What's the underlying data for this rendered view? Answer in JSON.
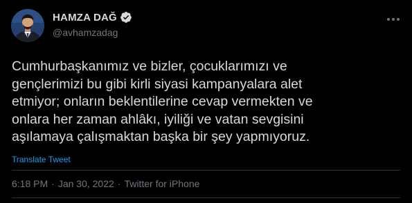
{
  "user": {
    "display_name": "HAMZA DAĞ",
    "handle": "@avhamzadag",
    "verified": true
  },
  "tweet": {
    "lines": [
      "Cumhurbaşkanımız ve bizler, çocuklarımızı ve",
      "gençlerimizi bu gibi kirli siyasi kampanyalara alet",
      "etmiyor; onların beklentilerine cevap vermekten ve",
      "onlara her zaman ahlâkı, iyiliği ve vatan sevgisini",
      "aşılamaya çalışmaktan başka bir şey yapmıyoruz."
    ],
    "translate_label": "Translate Tweet",
    "time": "6:18 PM",
    "separator": "·",
    "date": "Jan 30, 2022",
    "source": "Twitter for iPhone"
  },
  "icons": {
    "verified": "verified-badge-icon",
    "more": "more-options-icon"
  },
  "colors": {
    "background": "#000000",
    "text": "#d9d9d9",
    "muted": "#6e767d",
    "link": "#1d9bf0",
    "divider": "#2f3336"
  }
}
